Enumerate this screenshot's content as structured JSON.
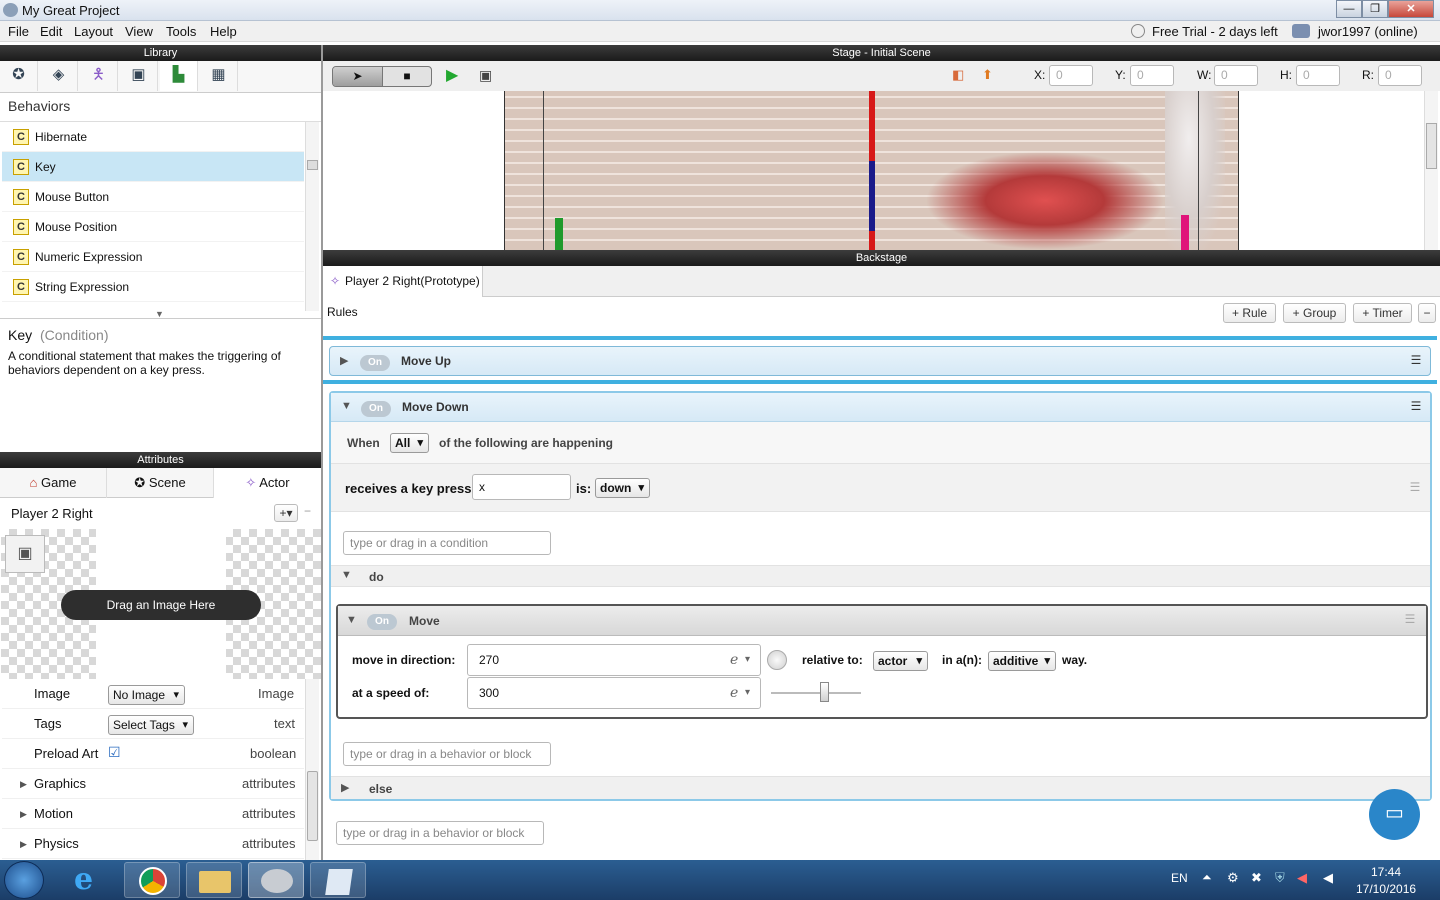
{
  "window": {
    "title": "My Great Project",
    "status": "Free Trial - 2 days left",
    "user": "jwor1997 (online)"
  },
  "menu": [
    "File",
    "Edit",
    "Layout",
    "View",
    "Tools",
    "Help"
  ],
  "library": {
    "header": "Library",
    "section": "Behaviors",
    "items": [
      {
        "label": "Hibernate"
      },
      {
        "label": "Key"
      },
      {
        "label": "Mouse Button"
      },
      {
        "label": "Mouse Position"
      },
      {
        "label": "Numeric Expression"
      },
      {
        "label": "String Expression"
      }
    ],
    "selected": "Key",
    "detail_title": "Key",
    "detail_type": "(Condition)",
    "detail_desc": "A conditional statement that makes the triggering of behaviors dependent on a key press."
  },
  "attributes": {
    "header": "Attributes",
    "tabs": [
      "Game",
      "Scene",
      "Actor"
    ],
    "actor_name": "Player 2 Right",
    "drag_text": "Drag an Image Here",
    "rows": [
      {
        "label": "Image",
        "value": "No Image",
        "type": "Image"
      },
      {
        "label": "Tags",
        "value": "Select Tags",
        "type": "text"
      },
      {
        "label": "Preload Art",
        "value": "☑",
        "type": "boolean"
      },
      {
        "label": "Graphics",
        "type": "attributes"
      },
      {
        "label": "Motion",
        "type": "attributes"
      },
      {
        "label": "Physics",
        "type": "attributes"
      }
    ]
  },
  "stage": {
    "header": "Stage - Initial Scene",
    "fields": [
      {
        "label": "X:",
        "value": "0"
      },
      {
        "label": "Y:",
        "value": "0"
      },
      {
        "label": "W:",
        "value": "0"
      },
      {
        "label": "H:",
        "value": "0"
      },
      {
        "label": "R:",
        "value": "0"
      }
    ]
  },
  "backstage": {
    "header": "Backstage",
    "tab": "Player 2 Right(Prototype)",
    "rules_label": "Rules",
    "buttons": [
      "+ Rule",
      "+ Group",
      "+ Timer",
      "−"
    ],
    "rule1": {
      "on": "On",
      "name": "Move Up"
    },
    "rule2": {
      "on": "On",
      "name": "Move Down",
      "when": "When",
      "when_value": "All",
      "when_suffix": "of the following are happening",
      "cond_label": "receives a key press:",
      "cond_key": "x",
      "cond_is": "is:",
      "cond_state": "down",
      "cond_placeholder": "type or drag in a condition",
      "do_label": "do",
      "move": {
        "on": "On",
        "name": "Move",
        "dir_label": "move in direction:",
        "dir_value": "270",
        "rel_label": "relative to:",
        "rel_value": "actor",
        "ina_label": "in a(n):",
        "ina_value": "additive",
        "way": "way.",
        "speed_label": "at a speed of:",
        "speed_value": "300",
        "e": "e"
      },
      "behavior_placeholder": "type or drag in a behavior or block",
      "else_label": "else"
    },
    "outer_placeholder": "type or drag in a behavior or block"
  },
  "taskbar": {
    "lang": "EN",
    "time": "17:44",
    "date": "17/10/2016"
  }
}
